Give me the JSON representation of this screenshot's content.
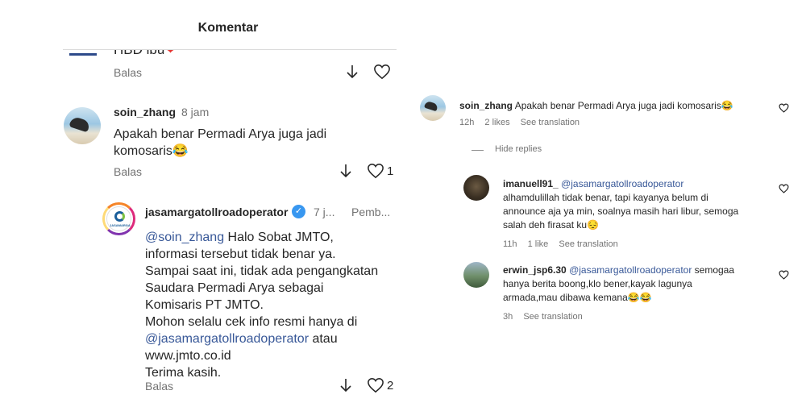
{
  "header": {
    "title": "Komentar"
  },
  "previous_comment": {
    "text": "HBD ibu",
    "emoji": "❤",
    "reply_label": "Balas"
  },
  "comment": {
    "username": "soin_zhang",
    "time": "8 jam",
    "text_line1": "Apakah benar Permadi Arya juga jadi",
    "text_line2": "komosaris😂",
    "reply_label": "Balas",
    "likes": "1"
  },
  "reply": {
    "username": "jasamargatollroadoperator",
    "time": "7 j...",
    "pinned_label": "Pemb...",
    "mention": "@soin_zhang",
    "line1_rest": " Halo Sobat JMTO,",
    "line2": "informasi tersebut tidak benar ya.",
    "line3": "Sampai saat ini, tidak ada pengangkatan",
    "line4": "Saudara Permadi Arya sebagai",
    "line5": "Komisaris PT JMTO.",
    "line6": "Mohon selalu cek info resmi hanya di",
    "mention2": "@jasamargatollroadoperator",
    "line7_rest": " atau",
    "line8": "www.jmto.co.id",
    "line9": "Terima kasih.",
    "reply_label": "Balas",
    "likes": "2",
    "avatar_text": "JASAMARGA"
  },
  "right_panel": {
    "main": {
      "username": "soin_zhang",
      "text": "Apakah benar Permadi Arya juga jadi komosaris😂",
      "time": "12h",
      "likes": "2 likes",
      "translate": "See translation"
    },
    "hide_replies": "Hide replies",
    "replies": [
      {
        "username": "imanuell91_",
        "mention": "@jasamargatollroadoperator",
        "line1": "alhamdulillah tidak benar, tapi kayanya belum di",
        "line2": "announce aja ya min, soalnya masih hari libur, semoga",
        "line3": "salah deh firasat ku😔",
        "time": "11h",
        "likes": "1 like",
        "translate": "See translation"
      },
      {
        "username": "erwin_jsp6.30",
        "mention": "@jasamargatollroadoperator",
        "line1_rest": " semogaa",
        "line2": "hanya berita boong,klo bener,kayak lagunya",
        "line3": "armada,mau dibawa kemana😂😂",
        "time": "3h",
        "translate": "See translation"
      }
    ]
  }
}
